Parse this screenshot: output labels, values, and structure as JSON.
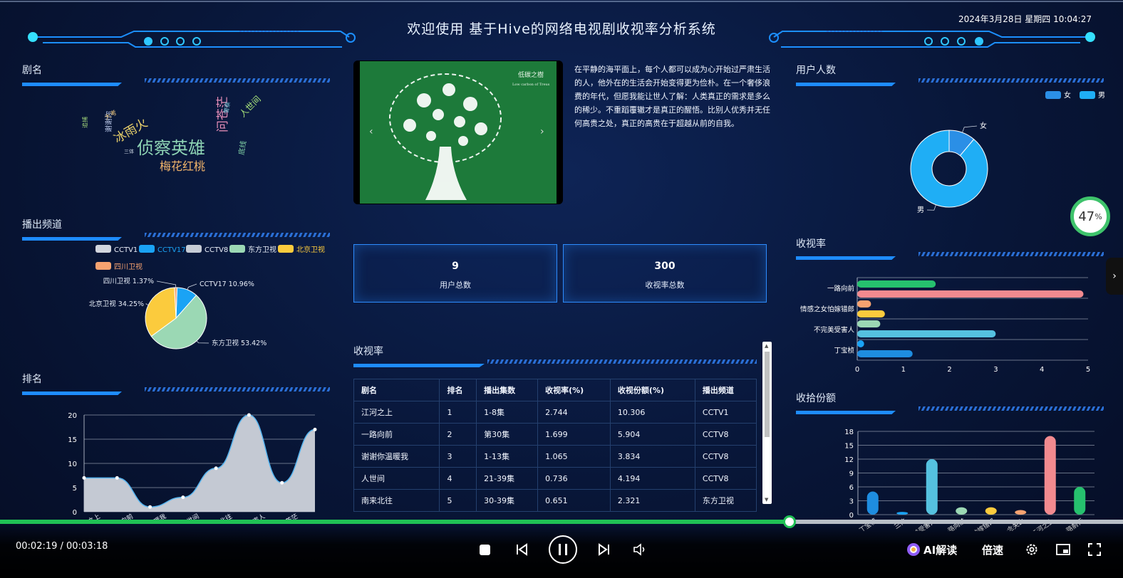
{
  "header": {
    "title": "欢迎使用 基于Hive的网络电视剧收视率分析系统",
    "datetime": "2024年3月28日 星期四 10:04:27"
  },
  "sections": {
    "drama_names": "剧名",
    "channels": "播出频道",
    "ranking": "排名",
    "users": "用户人数",
    "rating_bar": "收视率",
    "share": "收拾份额",
    "table": "收视率"
  },
  "word_cloud": [
    {
      "text": "侦察英雄",
      "color": "#8fd5b5",
      "size": 24
    },
    {
      "text": "梅花红桃",
      "color": "#f0b26a",
      "size": 16
    },
    {
      "text": "冰雨火",
      "color": "#ecd36b",
      "size": 17
    },
    {
      "text": "问苍茫",
      "color": "#e88fb9",
      "size": 17
    },
    {
      "text": "人世间",
      "color": "#a6e07a",
      "size": 12
    },
    {
      "text": "谢谢你",
      "color": "#b9c7e8",
      "size": 10
    },
    {
      "text": "底线",
      "color": "#82d3a6",
      "size": 10
    },
    {
      "text": "大考",
      "color": "#e7c27b",
      "size": 9
    },
    {
      "text": "追捕",
      "color": "#a3d77a",
      "size": 8
    },
    {
      "text": "三体",
      "color": "#c9d3e0",
      "size": 7
    },
    {
      "text": "警察",
      "color": "#7cc7d8",
      "size": 8
    }
  ],
  "carousel": {
    "prev": "‹",
    "next": "›",
    "caption": "低碳之樹",
    "caption_en": "Low carbon of Treus"
  },
  "intro_text": "在平静的海平面上，每个人都可以成为心开始过严肃生活的人，他外在的生活会开始变得更为俭朴。在一个奢侈浪费的年代，但愿我能让世人了解：人类真正的需求是多么的稀少。不重蹈覆辙才是真正的醒悟。比别人优秀并无任何高贵之处，真正的高贵在于超越从前的自我。",
  "stats": [
    {
      "value": "9",
      "label": "用户总数"
    },
    {
      "value": "300",
      "label": "收视率总数"
    }
  ],
  "table": {
    "headers": [
      "剧名",
      "排名",
      "播出集数",
      "收视率(%)",
      "收视份额(%)",
      "播出频道"
    ],
    "rows": [
      [
        "江河之上",
        "1",
        "1-8集",
        "2.744",
        "10.306",
        "CCTV1"
      ],
      [
        "一路向前",
        "2",
        "第30集",
        "1.699",
        "5.904",
        "CCTV8"
      ],
      [
        "谢谢你温暖我",
        "3",
        "1-13集",
        "1.065",
        "3.834",
        "CCTV8"
      ],
      [
        "人世间",
        "4",
        "21-39集",
        "0.736",
        "4.194",
        "CCTV8"
      ],
      [
        "南来北往",
        "5",
        "30-39集",
        "0.651",
        "2.321",
        "东方卫视"
      ]
    ]
  },
  "player": {
    "time": "00:02:19 / 00:03:18",
    "progress": 0.703,
    "ai_label": "AI解读",
    "speed_label": "倍速",
    "badge": "47",
    "badge_unit": "%"
  },
  "colors": {
    "accent": "#1e8cff",
    "progress": "#20c155"
  },
  "chart_data": [
    {
      "type": "pie",
      "legend": [
        "CCTV1",
        "CCTV17",
        "CCTV8",
        "东方卫视",
        "北京卫视",
        "四川卫视"
      ],
      "legend_colors": [
        "#d2d6de",
        "#1aa3f5",
        "#c6ccd6",
        "#9bd8b4",
        "#fbcb3d",
        "#f6a270"
      ],
      "slices": [
        {
          "name": "CCTV17",
          "value": 10.96,
          "label": "CCTV17 10.96%",
          "color": "#1aa3f5"
        },
        {
          "name": "东方卫视",
          "value": 53.42,
          "label": "东方卫视 53.42%",
          "color": "#9bd8b4"
        },
        {
          "name": "北京卫视",
          "value": 34.25,
          "label": "北京卫视 34.25%",
          "color": "#fbcb3d"
        },
        {
          "name": "四川卫视",
          "value": 1.37,
          "label": "四川卫视 1.37%",
          "color": "#f6a270"
        }
      ]
    },
    {
      "type": "area",
      "x": [
        "江河之上",
        "一路向前",
        "谢谢你温暖我",
        "人世间",
        "南来北往",
        "不完美受害人",
        "问苍茫"
      ],
      "x_display": [
        "江河之上",
        "一路向前",
        "谢谢你温暖我",
        "人世间",
        "南来北往",
        "不完美受害人",
        "问苍茫"
      ],
      "y": [
        7,
        7,
        1,
        3,
        9,
        20,
        6,
        17
      ],
      "ylim": [
        0,
        20
      ],
      "yticks": [
        "0",
        "5",
        "10",
        "15",
        "20"
      ]
    },
    {
      "type": "pie",
      "legend": [
        "女",
        "男"
      ],
      "slices": [
        {
          "name": "女",
          "value": 1,
          "label": "女",
          "color": "#2b8fe6"
        },
        {
          "name": "男",
          "value": 8,
          "label": "男",
          "color": "#1faef5"
        }
      ]
    },
    {
      "type": "bar",
      "orientation": "horizontal",
      "categories": [
        "丁宝桢",
        "不完美受害人",
        "情感之女怕嫁错郎",
        "一路向前"
      ],
      "bars": [
        {
          "value": 1.2,
          "color": "#1e8de0"
        },
        {
          "value": 0.15,
          "color": "#1aa3f5"
        },
        {
          "value": 3.0,
          "color": "#55c1df"
        },
        {
          "value": 0.5,
          "color": "#9bd8b4"
        },
        {
          "value": 0.6,
          "color": "#fbcb3d"
        },
        {
          "value": 0.3,
          "color": "#f6a270"
        },
        {
          "value": 4.9,
          "color": "#f28a8f"
        },
        {
          "value": 1.7,
          "color": "#26c16e"
        }
      ],
      "xlim": [
        0,
        5
      ],
      "xticks": [
        "0",
        "1",
        "2",
        "3",
        "4",
        "5"
      ]
    },
    {
      "type": "bar",
      "categories": [
        "丁宝桢",
        "三体",
        "不完美受害人",
        "一路向前",
        "情感之女怕嫁错郎",
        "一念关山",
        "江河之上",
        "一路前行"
      ],
      "values": [
        5,
        0.6,
        12,
        1.6,
        1.6,
        1,
        17,
        6
      ],
      "colors": [
        "#1e8de0",
        "#1aa3f5",
        "#55c1df",
        "#9bd8b4",
        "#fbcb3d",
        "#f6a270",
        "#f28a8f",
        "#26c16e"
      ],
      "ylim": [
        0,
        18
      ],
      "yticks": [
        "0",
        "3",
        "6",
        "9",
        "12",
        "15",
        "18"
      ]
    }
  ]
}
